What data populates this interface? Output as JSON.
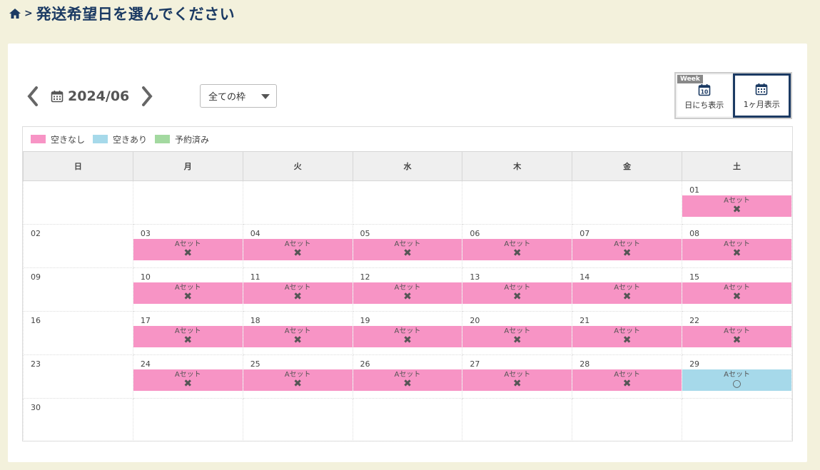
{
  "breadcrumb": {
    "separator": ">"
  },
  "page_title": "発送希望日を選んでください",
  "month_nav": {
    "label": "2024/06"
  },
  "slot_filter": {
    "selected": "全ての枠"
  },
  "view_toggle": {
    "week_badge": "Week",
    "day_label": "日にち表示",
    "day_icon_number": "10",
    "month_label": "1ヶ月表示"
  },
  "legend": [
    {
      "label": "空きなし",
      "color": "#f794c5"
    },
    {
      "label": "空きあり",
      "color": "#a6d9ea"
    },
    {
      "label": "予約済み",
      "color": "#a3d9a0"
    }
  ],
  "colors": {
    "full": "#f794c5",
    "available": "#a6d9ea",
    "booked": "#a3d9a0",
    "title": "#1b3a63"
  },
  "weekdays": [
    "日",
    "月",
    "火",
    "水",
    "木",
    "金",
    "土"
  ],
  "marks": {
    "full": "✖",
    "available": "○"
  },
  "weeks": [
    [
      {
        "day": "",
        "slot": null
      },
      {
        "day": "",
        "slot": null
      },
      {
        "day": "",
        "slot": null
      },
      {
        "day": "",
        "slot": null
      },
      {
        "day": "",
        "slot": null
      },
      {
        "day": "",
        "slot": null
      },
      {
        "day": "01",
        "slot": {
          "label": "Aセット",
          "status": "full"
        }
      }
    ],
    [
      {
        "day": "02",
        "slot": null
      },
      {
        "day": "03",
        "slot": {
          "label": "Aセット",
          "status": "full"
        }
      },
      {
        "day": "04",
        "slot": {
          "label": "Aセット",
          "status": "full"
        }
      },
      {
        "day": "05",
        "slot": {
          "label": "Aセット",
          "status": "full"
        }
      },
      {
        "day": "06",
        "slot": {
          "label": "Aセット",
          "status": "full"
        }
      },
      {
        "day": "07",
        "slot": {
          "label": "Aセット",
          "status": "full"
        }
      },
      {
        "day": "08",
        "slot": {
          "label": "Aセット",
          "status": "full"
        }
      }
    ],
    [
      {
        "day": "09",
        "slot": null
      },
      {
        "day": "10",
        "slot": {
          "label": "Aセット",
          "status": "full"
        }
      },
      {
        "day": "11",
        "slot": {
          "label": "Aセット",
          "status": "full"
        }
      },
      {
        "day": "12",
        "slot": {
          "label": "Aセット",
          "status": "full"
        }
      },
      {
        "day": "13",
        "slot": {
          "label": "Aセット",
          "status": "full"
        }
      },
      {
        "day": "14",
        "slot": {
          "label": "Aセット",
          "status": "full"
        }
      },
      {
        "day": "15",
        "slot": {
          "label": "Aセット",
          "status": "full"
        }
      }
    ],
    [
      {
        "day": "16",
        "slot": null
      },
      {
        "day": "17",
        "slot": {
          "label": "Aセット",
          "status": "full"
        }
      },
      {
        "day": "18",
        "slot": {
          "label": "Aセット",
          "status": "full"
        }
      },
      {
        "day": "19",
        "slot": {
          "label": "Aセット",
          "status": "full"
        }
      },
      {
        "day": "20",
        "slot": {
          "label": "Aセット",
          "status": "full"
        }
      },
      {
        "day": "21",
        "slot": {
          "label": "Aセット",
          "status": "full"
        }
      },
      {
        "day": "22",
        "slot": {
          "label": "Aセット",
          "status": "full"
        }
      }
    ],
    [
      {
        "day": "23",
        "slot": null
      },
      {
        "day": "24",
        "slot": {
          "label": "Aセット",
          "status": "full"
        }
      },
      {
        "day": "25",
        "slot": {
          "label": "Aセット",
          "status": "full"
        }
      },
      {
        "day": "26",
        "slot": {
          "label": "Aセット",
          "status": "full"
        }
      },
      {
        "day": "27",
        "slot": {
          "label": "Aセット",
          "status": "full"
        }
      },
      {
        "day": "28",
        "slot": {
          "label": "Aセット",
          "status": "full"
        }
      },
      {
        "day": "29",
        "slot": {
          "label": "Aセット",
          "status": "available"
        }
      }
    ],
    [
      {
        "day": "30",
        "slot": null
      },
      {
        "day": "",
        "slot": null
      },
      {
        "day": "",
        "slot": null
      },
      {
        "day": "",
        "slot": null
      },
      {
        "day": "",
        "slot": null
      },
      {
        "day": "",
        "slot": null
      },
      {
        "day": "",
        "slot": null
      }
    ]
  ]
}
